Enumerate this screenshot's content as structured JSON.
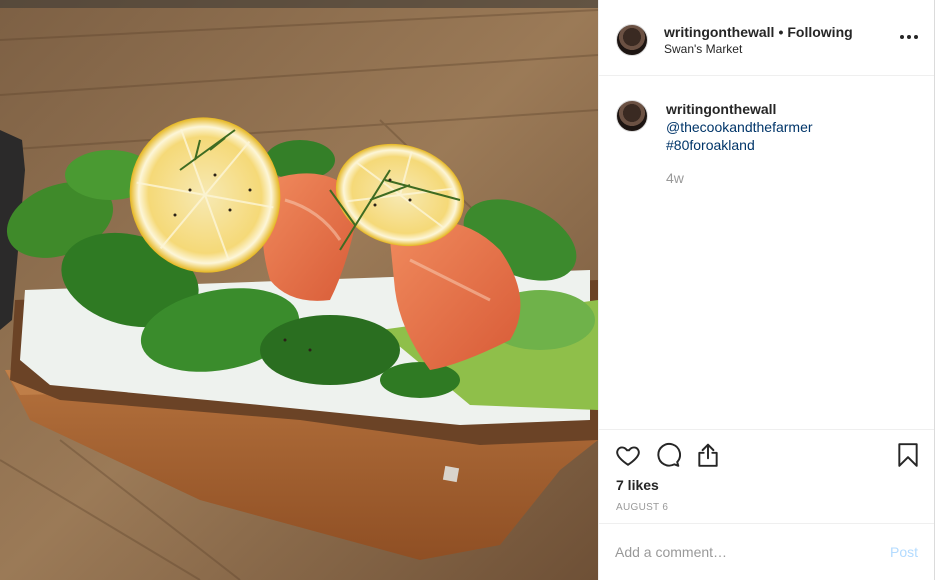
{
  "post": {
    "photo_alt": "smoked-salmon-toast-photo",
    "header": {
      "username": "writingonthewall",
      "separator": "•",
      "follow_status": "Following",
      "location": "Swan's Market",
      "more_icon": "more-horizontal-icon"
    },
    "caption": {
      "username": "writingonthewall",
      "mention": "@thecookandthefarmer",
      "hashtag": "#80foroakland",
      "time_ago": "4w"
    },
    "actions": {
      "like_icon": "heart-icon",
      "comment_icon": "comment-bubble-icon",
      "share_icon": "share-icon",
      "save_icon": "bookmark-icon"
    },
    "likes_text": "7 likes",
    "date": "AUGUST 6",
    "comment_form": {
      "placeholder": "Add a comment…",
      "post_label": "Post"
    }
  },
  "colors": {
    "link": "#003569",
    "muted": "#999999",
    "post_disabled": "#b3dbff",
    "text": "#262626",
    "border": "#efefef"
  }
}
